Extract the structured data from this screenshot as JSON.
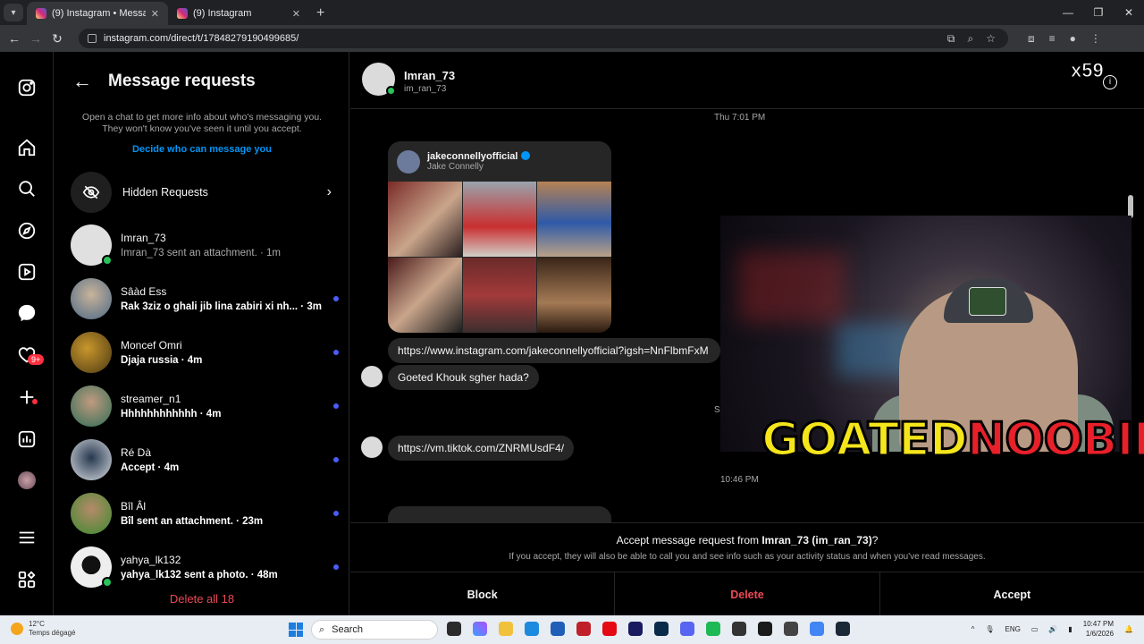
{
  "browser": {
    "tabs": [
      {
        "label": "(9) Instagram • Messages",
        "active": true
      },
      {
        "label": "(9) Instagram",
        "active": false
      }
    ],
    "url": "instagram.com/direct/t/17848279190499685/"
  },
  "nav": {
    "badge": "9+",
    "icons": [
      "instagram-icon",
      "home-icon",
      "search-icon",
      "explore-icon",
      "reels-icon",
      "messages-icon",
      "notifications-icon",
      "create-icon",
      "dashboard-icon",
      "profile-avatar",
      "more-menu-icon",
      "also-from-meta-icon"
    ]
  },
  "requests": {
    "title": "Message requests",
    "info": "Open a chat to get more info about who's messaging you. They won't know you've seen it until you accept.",
    "link": "Decide who can message you",
    "hidden_label": "Hidden Requests",
    "delete_all": "Delete all 18",
    "items": [
      {
        "name": "Imran_73",
        "preview": "Imran_73 sent an attachment. · 1m",
        "unread": false
      },
      {
        "name": "Sâàd Ess",
        "preview": "Rak 3ziz o ghali jib lina zabiri xi nh... · 3m",
        "unread": true
      },
      {
        "name": "Moncef Omri",
        "preview": "Djaja russia · 4m",
        "unread": true
      },
      {
        "name": "streamer_n1",
        "preview": "Hhhhhhhhhhhh · 4m",
        "unread": true
      },
      {
        "name": "Ré Dà",
        "preview": "Accept · 4m",
        "unread": true
      },
      {
        "name": "Bîl Âl",
        "preview": "Bîl sent an attachment. · 23m",
        "unread": true
      },
      {
        "name": "yahya_lk132",
        "preview": "yahya_lk132 sent a photo. · 48m",
        "unread": true
      }
    ]
  },
  "chat": {
    "name": "Imran_73",
    "username": "im_ran_73",
    "timestamp1": "Thu 7:01 PM",
    "shared_account": "jakeconnellyofficial",
    "shared_name": "Jake Connelly",
    "link1": "https://www.instagram.com/jakeconnellyofficial?igsh=NnFlbmFxM",
    "msg1": "Goeted Khouk sgher hada?",
    "partial_ts": "Sa",
    "link2": "https://vm.tiktok.com/ZNRMUsdF4/",
    "timestamp2": "10:46 PM",
    "accept_prefix": "Accept message request from ",
    "accept_user": "Imran_73 (im_ran_73)",
    "accept_suffix": "?",
    "accept_note": "If you accept, they will also be able to call you and see info such as your activity status and when you've read messages.",
    "btn_block": "Block",
    "btn_delete": "Delete",
    "btn_accept": "Accept"
  },
  "overlay": {
    "logo_part1": "GOATED",
    "logo_part2": "NOOBIE",
    "counter": "x59"
  },
  "taskbar": {
    "temp": "12°C",
    "weather": "Temps dégagé",
    "search": "Search",
    "lang": "ENG",
    "time": "10:47 PM",
    "date": "1/6/2026"
  }
}
